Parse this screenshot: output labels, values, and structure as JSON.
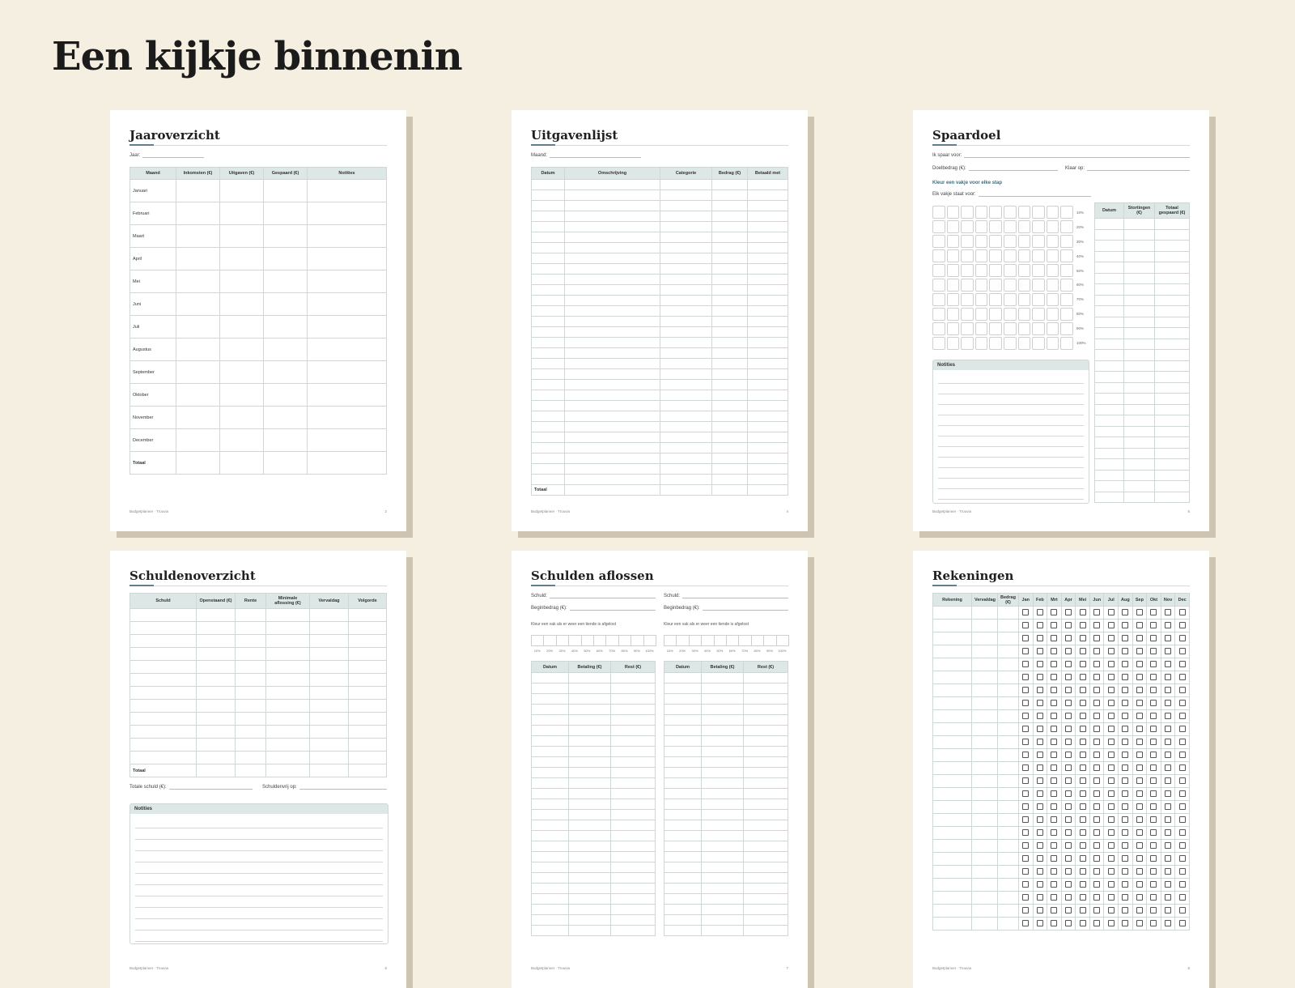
{
  "header": {
    "title": "Een kijkje binnenin"
  },
  "footer_brand": "Budgetplanner · Trouvia",
  "pages": {
    "jaaroverzicht": {
      "title": "Jaaroverzicht",
      "year_label": "Jaar:",
      "columns": [
        "Maand",
        "Inkomsten (€)",
        "Uitgaven (€)",
        "Gespaard (€)",
        "Notities"
      ],
      "months": [
        "Januari",
        "Februari",
        "Maart",
        "April",
        "Mei",
        "Juni",
        "Juli",
        "Augustus",
        "September",
        "Oktober",
        "November",
        "December"
      ],
      "total_label": "Totaal",
      "page_number": "2"
    },
    "uitgavenlijst": {
      "title": "Uitgavenlijst",
      "month_label": "Maand:",
      "columns": [
        "Datum",
        "Omschrijving",
        "Categorie",
        "Bedrag (€)",
        "Betaald met"
      ],
      "total_label": "Totaal",
      "page_number": "4"
    },
    "spaardoel": {
      "title": "Spaardoel",
      "save_for_label": "Ik spaar voor:",
      "target_label": "Doelbedrag (€):",
      "ready_label": "Klaar op:",
      "instruction": "Kleur een vakje voor elke stap",
      "box_label": "Elk vakje staat voor:",
      "percentages": [
        "10%",
        "20%",
        "30%",
        "40%",
        "50%",
        "60%",
        "70%",
        "80%",
        "90%",
        "100%"
      ],
      "notes_label": "Notities",
      "columns": [
        "Datum",
        "Stortingen (€)",
        "Totaal gespaard (€)"
      ],
      "page_number": "5"
    },
    "schuldenoverzicht": {
      "title": "Schuldenoverzicht",
      "columns": [
        "Schuld",
        "Openstaand (€)",
        "Rente",
        "Minimale aflossing (€)",
        "Vervaldag",
        "Volgorde"
      ],
      "total_label": "Totaal",
      "total_debt_label": "Totale schuld (€):",
      "debt_free_label": "Schuldenvrij op:",
      "notes_label": "Notities",
      "page_number": "6"
    },
    "schulden_aflossen": {
      "title": "Schulden aflossen",
      "debt_label": "Schuld:",
      "start_label": "Beginbedrag (€):",
      "instruction": "Kleur een vak als er weer een tiende is afgelost",
      "percentages": [
        "10%",
        "20%",
        "30%",
        "40%",
        "50%",
        "60%",
        "70%",
        "80%",
        "90%",
        "100%"
      ],
      "columns": [
        "Datum",
        "Betaling (€)",
        "Rest (€)"
      ],
      "page_number": "7"
    },
    "rekeningen": {
      "title": "Rekeningen",
      "columns": [
        "Rekening",
        "Vervaldag",
        "Bedrag (€)"
      ],
      "months": [
        "Jan",
        "Feb",
        "Mrt",
        "Apr",
        "Mei",
        "Jun",
        "Jul",
        "Aug",
        "Sep",
        "Okt",
        "Nov",
        "Dec"
      ],
      "page_number": "8"
    }
  }
}
